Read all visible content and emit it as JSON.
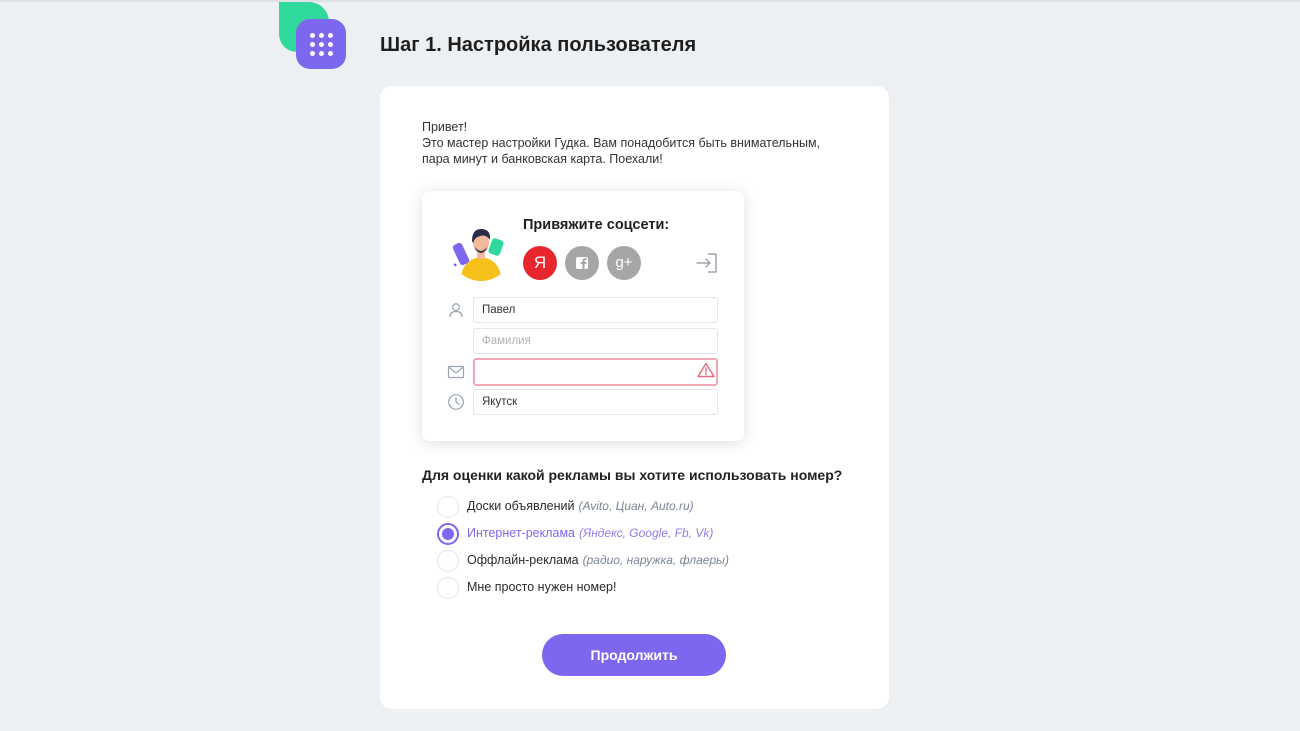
{
  "header": {
    "title": "Шаг 1. Настройка пользователя",
    "logo_icon": "apps-grid-icon"
  },
  "intro": {
    "line1": "Привет!",
    "line2": "Это мастер настройки Гудка. Вам понадобится быть внимательным,",
    "line3": "пара минут и банковская карта. Поехали!"
  },
  "social": {
    "title": "Привяжите соцсети:",
    "yandex_label": "Я",
    "facebook_label": "f",
    "google_label": "g+",
    "colors": {
      "yandex": "#e8262d",
      "inactive": "#a6a6a6"
    }
  },
  "form": {
    "first_name_value": "Павел",
    "first_name_placeholder": "",
    "last_name_value": "",
    "last_name_placeholder": "Фамилия",
    "email_value": "",
    "email_placeholder": "",
    "timezone_value": "Якутск",
    "timezone_placeholder": ""
  },
  "question": {
    "title": "Для оценки какой рекламы вы хотите использовать номер?",
    "options": [
      {
        "label": "Доски объявлений",
        "note": "(Avito, Циан, Auto.ru)",
        "checked": false
      },
      {
        "label": "Интернет-реклама",
        "note": "(Яндекс, Google, Fb, Vk)",
        "checked": true
      },
      {
        "label": "Оффлайн-реклама",
        "note": "(радио, наружка, флаеры)",
        "checked": false
      },
      {
        "label": "Мне просто нужен номер!",
        "note": "",
        "checked": false
      }
    ]
  },
  "actions": {
    "continue_label": "Продолжить"
  },
  "colors": {
    "accent": "#7b68ee",
    "brand_green": "#2fd99c",
    "error_border": "#f2a7b4",
    "background": "#edf0f3"
  }
}
